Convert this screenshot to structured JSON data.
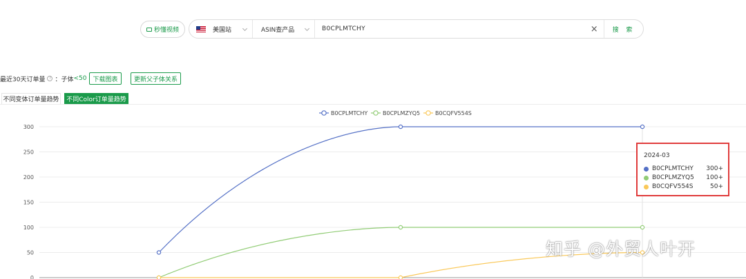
{
  "search": {
    "video_button_label": "秒懂视频",
    "site_label": "美国站",
    "type_label": "ASIN查产品",
    "query_value": "B0CPLMTCHY",
    "clear_symbol": "×",
    "search_button_label": "搜 索"
  },
  "header": {
    "title": "最近30天订单量",
    "help_symbol": "?",
    "subbody_prefix": "：子体",
    "subbody_value": "<50",
    "download_button": "下载图表",
    "update_button": "更新父子体关系"
  },
  "tabs": [
    {
      "label": "不同变体订单量趋势",
      "active": false
    },
    {
      "label": "不同Color订单量趋势",
      "active": true
    }
  ],
  "chart_data": {
    "type": "line",
    "x": [
      "",
      "",
      "2024-03"
    ],
    "ylim": [
      0,
      300
    ],
    "yticks": [
      0,
      50,
      100,
      150,
      200,
      250,
      300
    ],
    "grid": true,
    "legend_position": "top-center",
    "series": [
      {
        "name": "B0CPLMTCHY",
        "color": "#5470c6",
        "values": [
          50,
          300,
          300
        ]
      },
      {
        "name": "B0CPLMZYQ5",
        "color": "#91cc75",
        "values": [
          0,
          100,
          100
        ]
      },
      {
        "name": "B0CQFV554S",
        "color": "#fac858",
        "values": [
          0,
          0,
          50
        ]
      }
    ]
  },
  "tooltip": {
    "title": "2024-03",
    "rows": [
      {
        "name": "B0CPLMTCHY",
        "value": "300+",
        "color": "#5470c6"
      },
      {
        "name": "B0CPLMZYQ5",
        "value": "100+",
        "color": "#91cc75"
      },
      {
        "name": "B0CQFV554S",
        "value": "50+",
        "color": "#fac858"
      }
    ]
  },
  "watermark": "知乎 @外贸人叶开"
}
